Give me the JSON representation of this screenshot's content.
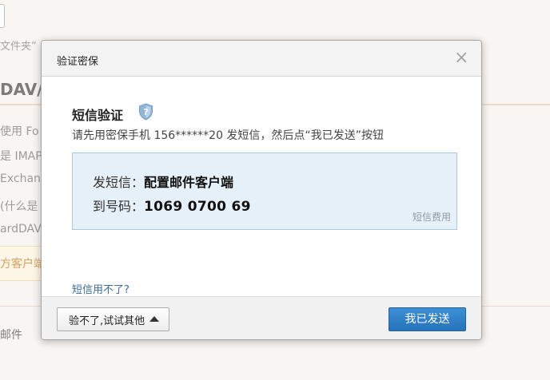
{
  "background": {
    "folder_text": "文件夹”",
    "dots_text": "...",
    "heading": "DAV/",
    "lines": [
      "使用 Fo",
      "是 IMAP",
      "Exchan",
      "(什么是",
      "ardDAV"
    ],
    "notice_text": "方客户端",
    "mail_text": "邮件"
  },
  "modal": {
    "title": "验证密保",
    "section_title": "短信验证",
    "instruction": "请先用密保手机 156******20 发短信，然后点“我已发送”按钮",
    "sms": {
      "content_label": "发短信：",
      "content_value": "配置邮件客户端",
      "number_label": "到号码：",
      "number_value": "1069 0700 69",
      "fee_link": "短信费用"
    },
    "help_link": "短信用不了?",
    "alt_button": "验不了,试试其他",
    "primary_button": "我已发送"
  }
}
